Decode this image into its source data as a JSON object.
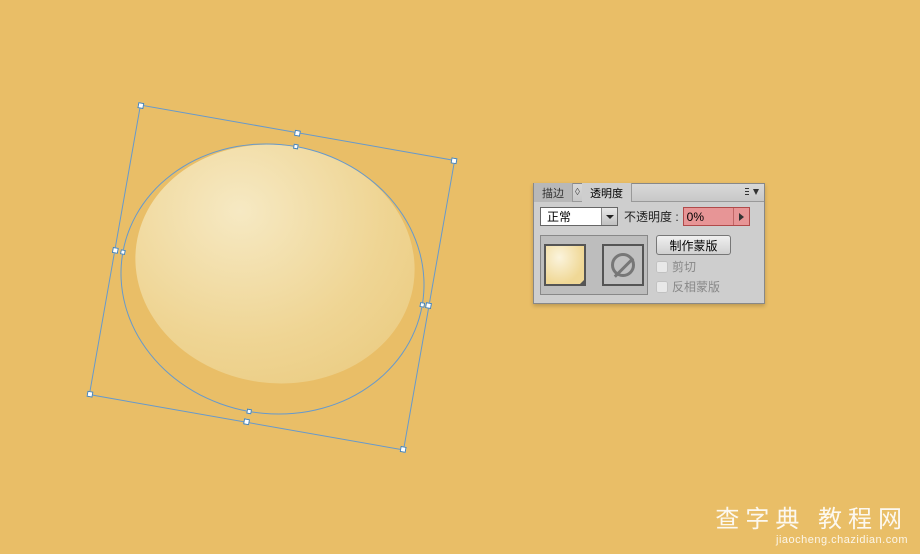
{
  "panel": {
    "tab_stroke": "描边",
    "tab_transparency": "透明度",
    "blend_mode": "正常",
    "opacity_label": "不透明度 :",
    "opacity_value": "0%",
    "make_mask": "制作蒙版",
    "clip": "剪切",
    "invert_mask": "反相蒙版"
  },
  "footer": {
    "line1": "查字典 教程网",
    "line2": "jiaocheng.chazidian.com"
  }
}
